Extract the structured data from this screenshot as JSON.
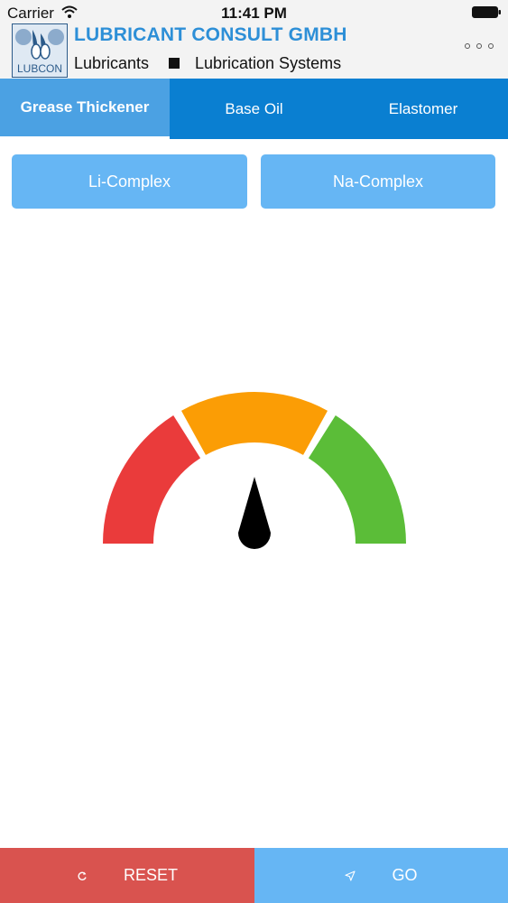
{
  "status_bar": {
    "carrier": "Carrier",
    "time": "11:41 PM"
  },
  "header": {
    "logo_text": "LUBCON",
    "company_name": "LUBRICANT CONSULT GMBH",
    "tagline_left": "Lubricants",
    "tagline_right": "Lubrication Systems",
    "brand_color": "#2d8fd7"
  },
  "tabs": [
    {
      "label": "Grease Thickener",
      "active": true
    },
    {
      "label": "Base Oil",
      "active": false
    },
    {
      "label": "Elastomer",
      "active": false
    }
  ],
  "options": [
    {
      "label": "Li-Complex"
    },
    {
      "label": "Na-Complex"
    }
  ],
  "gauge": {
    "segments": [
      {
        "color": "#ea3b3b"
      },
      {
        "color": "#fb9d05"
      },
      {
        "color": "#5bbd38"
      }
    ],
    "needle_color": "#000000",
    "needle_level": 0.5
  },
  "bottom_bar": {
    "reset_label": "RESET",
    "reset_icon": "refresh-icon",
    "reset_color": "#d9534f",
    "go_label": "GO",
    "go_icon": "send-icon",
    "go_color": "#66b6f4"
  }
}
